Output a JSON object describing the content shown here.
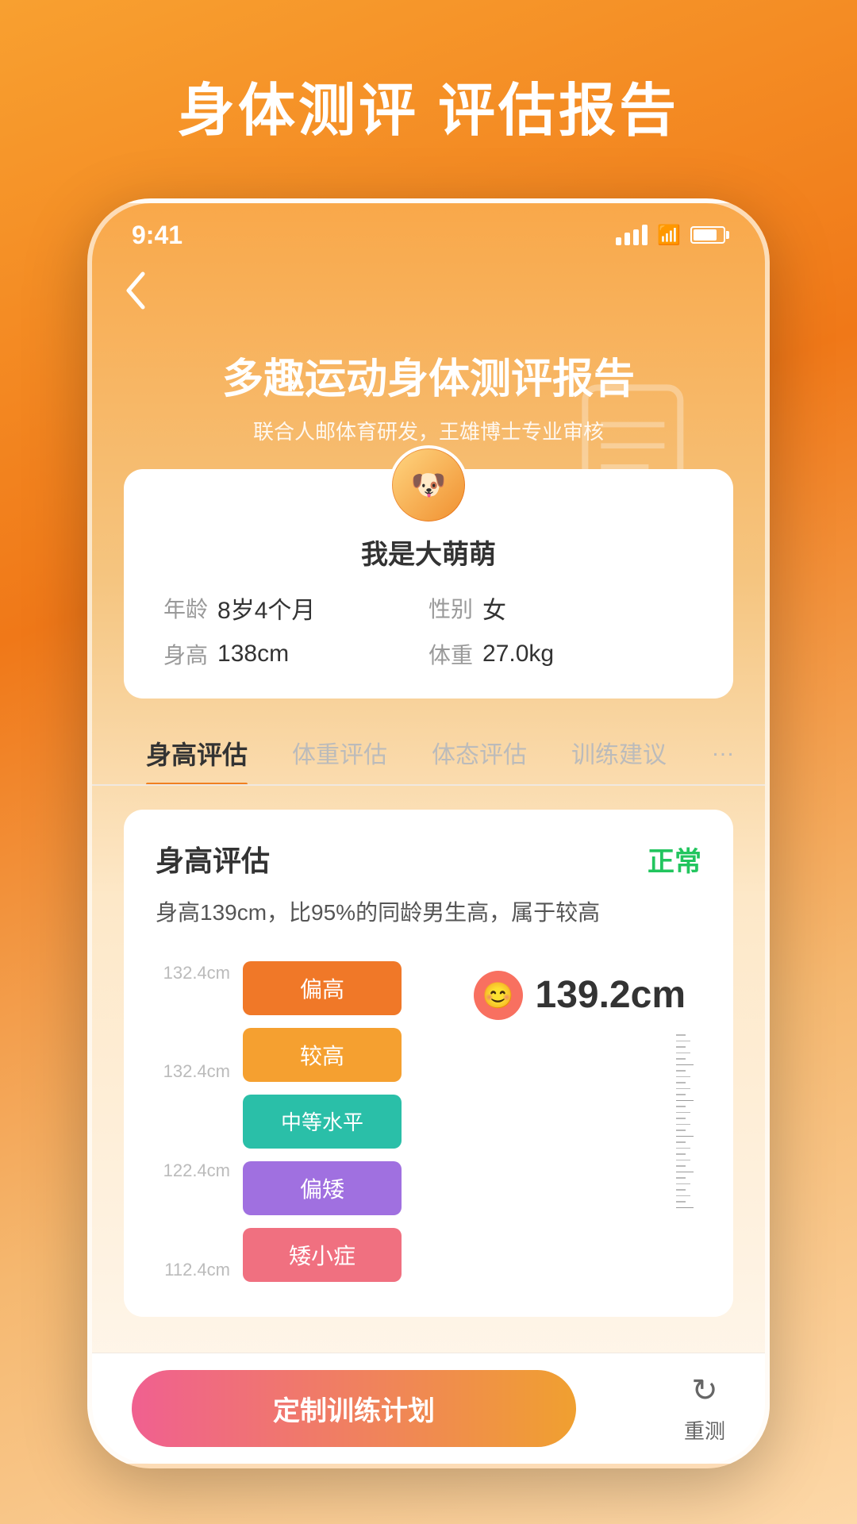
{
  "page": {
    "bg_title": "身体测评 评估报告"
  },
  "statusBar": {
    "time": "9:41"
  },
  "back": "‹",
  "report": {
    "title": "多趣运动身体测评报告",
    "subtitle": "联合人邮体育研发，王雄博士专业审核"
  },
  "user": {
    "name": "我是大萌萌",
    "age_label": "年龄",
    "age_value": "8岁4个月",
    "gender_label": "性别",
    "gender_value": "女",
    "height_label": "身高",
    "height_value": "138cm",
    "weight_label": "体重",
    "weight_value": "27.0kg"
  },
  "tabs": [
    {
      "label": "身高评估",
      "active": true
    },
    {
      "label": "体重评估",
      "active": false
    },
    {
      "label": "体态评估",
      "active": false
    },
    {
      "label": "训练建议",
      "active": false
    },
    {
      "label": "…",
      "active": false
    }
  ],
  "evaluation": {
    "title": "身高评估",
    "status": "正常",
    "description": "身高139cm，比95%的同龄男生高，属于较高",
    "measured_height": "139.2cm",
    "chart": {
      "bars": [
        {
          "label": "偏高",
          "color": "orange-dark"
        },
        {
          "label": "较高",
          "color": "orange"
        },
        {
          "label": "中等水平",
          "color": "teal"
        },
        {
          "label": "偏矮",
          "color": "purple"
        },
        {
          "label": "矮小症",
          "color": "pink"
        }
      ],
      "axis_labels": [
        "132.4cm",
        "132.4cm",
        "122.4cm",
        "112.4cm"
      ]
    }
  },
  "bottomBar": {
    "action_label": "定制训练计划",
    "reset_label": "重测"
  }
}
